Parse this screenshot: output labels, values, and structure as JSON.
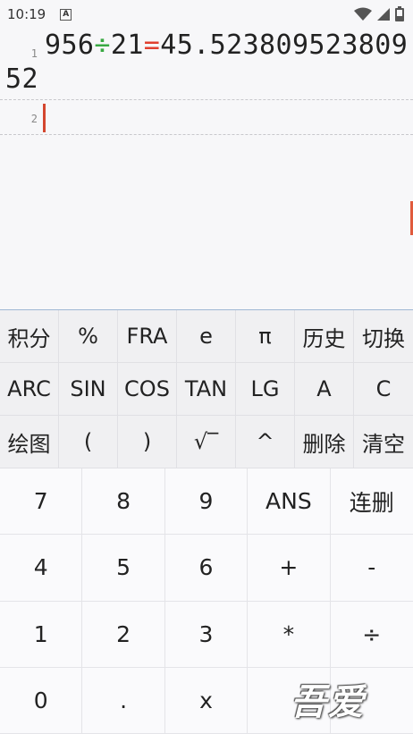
{
  "status_bar": {
    "time": "10:19",
    "notification_badge": "A",
    "icons": [
      "wifi-icon",
      "cell-signal-icon",
      "battery-icon"
    ]
  },
  "editor": {
    "lines": [
      {
        "number": "1",
        "operand1": "956",
        "operator": "÷",
        "operand2": "21",
        "equals": "=",
        "result": "45.52380952380952"
      },
      {
        "number": "2",
        "text": ""
      }
    ],
    "accent_colors": {
      "operator": "#39a943",
      "equals": "#e0402f",
      "caret": "#d4462f"
    }
  },
  "function_keys": [
    [
      "积分",
      "%",
      "FRA",
      "e",
      "π",
      "历史",
      "切换"
    ],
    [
      "ARC",
      "SIN",
      "COS",
      "TAN",
      "LG",
      "A",
      "C"
    ],
    [
      "绘图",
      "(",
      ")",
      "√‾",
      "^",
      "删除",
      "清空"
    ]
  ],
  "number_keys": [
    [
      "7",
      "8",
      "9",
      "ANS",
      "连删"
    ],
    [
      "4",
      "5",
      "6",
      "+",
      "-"
    ],
    [
      "1",
      "2",
      "3",
      "*",
      "÷"
    ],
    [
      "0",
      ".",
      "x",
      "",
      ""
    ]
  ],
  "watermark": "吾爱"
}
